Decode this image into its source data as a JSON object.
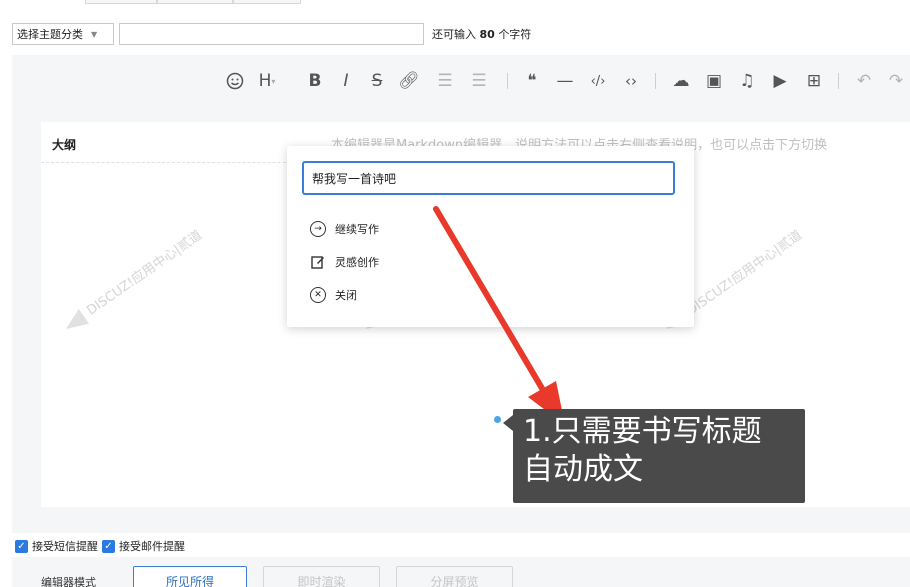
{
  "form": {
    "type_select": "选择主题分类",
    "char_hint_prefix": "还可输入",
    "char_count": "80",
    "char_hint_suffix": "个字符"
  },
  "editor": {
    "outline_label": "大纲",
    "markdown_hint": "本编辑器是Markdown编辑器，说明方法可以点击右侧查看说明，也可以点击下方切换",
    "toolbar_icons": [
      "emoji-icon",
      "heading-icon",
      "bold-icon",
      "italic-icon",
      "strikethrough-icon",
      "link-icon",
      "indent-icon",
      "outdent-icon",
      "quote-icon",
      "horizontal-rule-icon",
      "inline-code-icon",
      "code-block-icon",
      "upload-icon",
      "image-icon",
      "music-icon",
      "video-icon",
      "table-icon",
      "undo-icon",
      "redo-icon"
    ],
    "watermark_text": "DISCUZ!应用中心|贰道",
    "watermark_sub": "addon.dismall.com"
  },
  "ai_popup": {
    "prompt_value": "帮我写一首诗吧",
    "items": [
      {
        "label": "继续写作",
        "icon": "arrow-circle-icon"
      },
      {
        "label": "灵感创作",
        "icon": "edit-icon"
      },
      {
        "label": "关闭",
        "icon": "close-circle-icon"
      }
    ]
  },
  "tooltip": {
    "line1": "1.只需要书写标题",
    "line2": "自动成文"
  },
  "notify": {
    "sms_label": "接受短信提醒",
    "email_label": "接受邮件提醒"
  },
  "mode": {
    "label": "编辑器模式",
    "buttons": [
      "所见所得",
      "即时渲染",
      "分屏预览"
    ]
  },
  "colors": {
    "accent": "#3a7fd5",
    "arrow": "#e8392b",
    "tooltip_bg": "#4a4a4a"
  }
}
